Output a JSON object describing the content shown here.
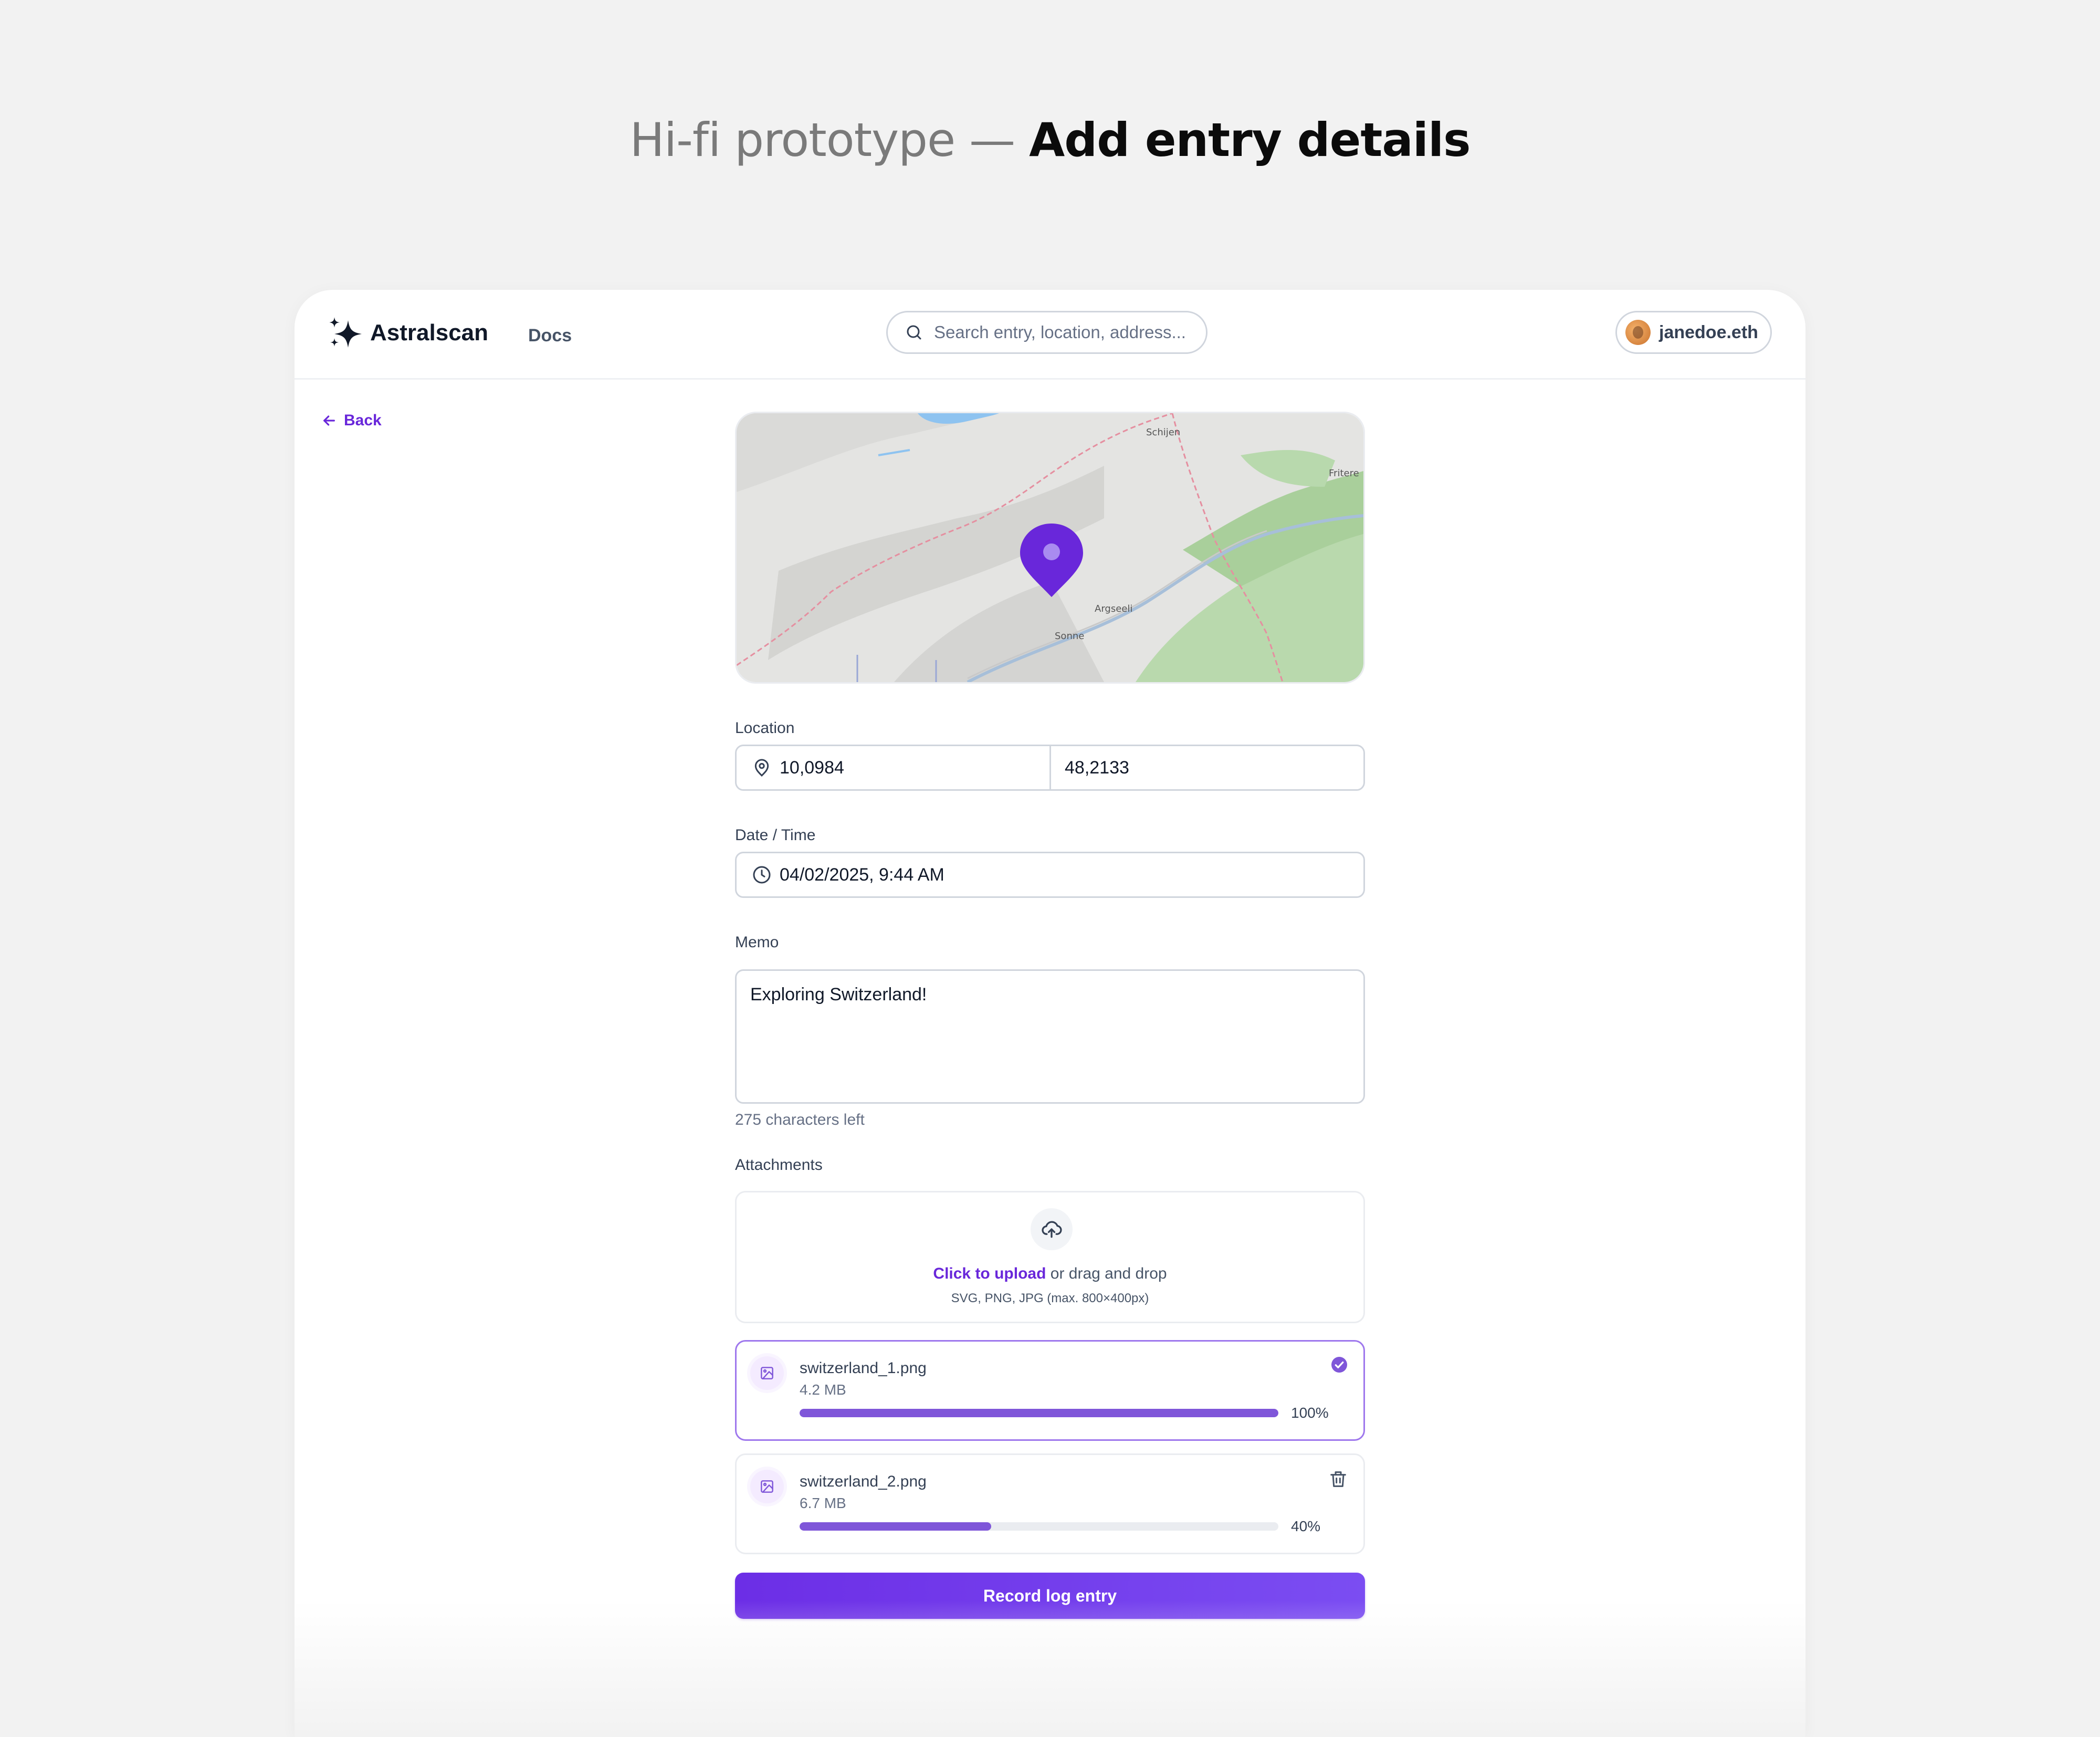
{
  "headline": {
    "prefix": "Hi-fi prototype —",
    "title": "Add entry details"
  },
  "header": {
    "brand": "Astralscan",
    "docs_link": "Docs",
    "search_placeholder": "Search entry, location, address...",
    "user": "janedoe.eth"
  },
  "nav": {
    "back": "Back"
  },
  "map": {
    "labels": [
      "Schijen",
      "Fritere",
      "Argseeli",
      "Sonne"
    ],
    "marker_color": "#6927da"
  },
  "form": {
    "location": {
      "label": "Location",
      "lat": "10,0984",
      "lng": "48,2133"
    },
    "datetime": {
      "label": "Date / Time",
      "value": "04/02/2025, 9:44 AM"
    },
    "memo": {
      "label": "Memo",
      "value": "Exploring Switzerland!",
      "hint": "275 characters left"
    },
    "attachments": {
      "label": "Attachments",
      "upload_click": "Click to upload",
      "upload_rest": " or drag and drop",
      "upload_formats": "SVG, PNG, JPG (max. 800×400px)",
      "files": [
        {
          "name": "switzerland_1.png",
          "size": "4.2 MB",
          "progress": 100,
          "progress_label": "100%",
          "status": "complete"
        },
        {
          "name": "switzerland_2.png",
          "size": "6.7 MB",
          "progress": 40,
          "progress_label": "40%",
          "status": "uploading"
        }
      ]
    },
    "submit": "Record log entry"
  },
  "colors": {
    "accent": "#6927da",
    "progress": "#7f56d9"
  }
}
